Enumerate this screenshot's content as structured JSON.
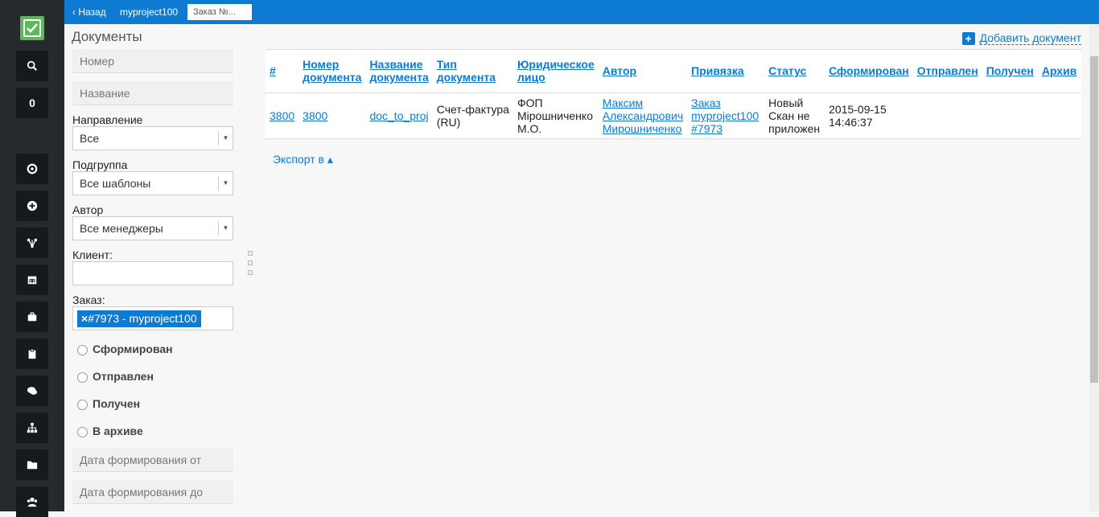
{
  "topbar": {
    "back": "‹ Назад",
    "project": "myproject100",
    "tab_input": "Заказ №..."
  },
  "page_title": "Документы",
  "add_document": "Добавить документ",
  "sidebar": {
    "counter": "0"
  },
  "filters": {
    "number_placeholder": "Номер",
    "name_placeholder": "Название",
    "direction_label": "Направление",
    "direction_value": "Все",
    "subgroup_label": "Подгруппа",
    "subgroup_value": "Все шаблоны",
    "author_label": "Автор",
    "author_value": "Все менеджеры",
    "client_label": "Клиент:",
    "order_label": "Заказ:",
    "order_tag": "#7973 - myproject100",
    "order_tag_remove": "×",
    "radios": [
      "Сформирован",
      "Отправлен",
      "Получен",
      "В архиве"
    ],
    "date_from_placeholder": "Дата формирования от",
    "date_to_placeholder": "Дата формирования до"
  },
  "table": {
    "headers": {
      "id": "#",
      "doc_number_1": "Номер",
      "doc_number_2": "документа",
      "doc_name_1": "Название",
      "doc_name_2": "документа",
      "doc_type_1": "Тип",
      "doc_type_2": "документа",
      "legal_1": "Юридическое",
      "legal_2": "лицо",
      "author": "Автор",
      "binding": "Привязка",
      "status": "Статус",
      "formed": "Сформирован",
      "sent": "Отправлен",
      "received": "Получен",
      "archive": "Архив"
    },
    "row": {
      "id": "3800",
      "doc_number": "3800",
      "doc_name": "doc_to_proj",
      "type_1": "Счет-фактура",
      "type_2": "(RU)",
      "legal_1": "ФОП",
      "legal_2": "Мірошниченко",
      "legal_3": "М.О.",
      "author_1": "Максим",
      "author_2": "Александрович",
      "author_3": "Мирошниченко",
      "binding_1": "Заказ",
      "binding_2": "myproject100",
      "binding_3": "#7973",
      "status_1": "Новый",
      "status_2": "Скан не",
      "status_3": "приложен",
      "formed_1": "2015-09-15",
      "formed_2": "14:46:37"
    }
  },
  "export": "Экспорт в ▴"
}
